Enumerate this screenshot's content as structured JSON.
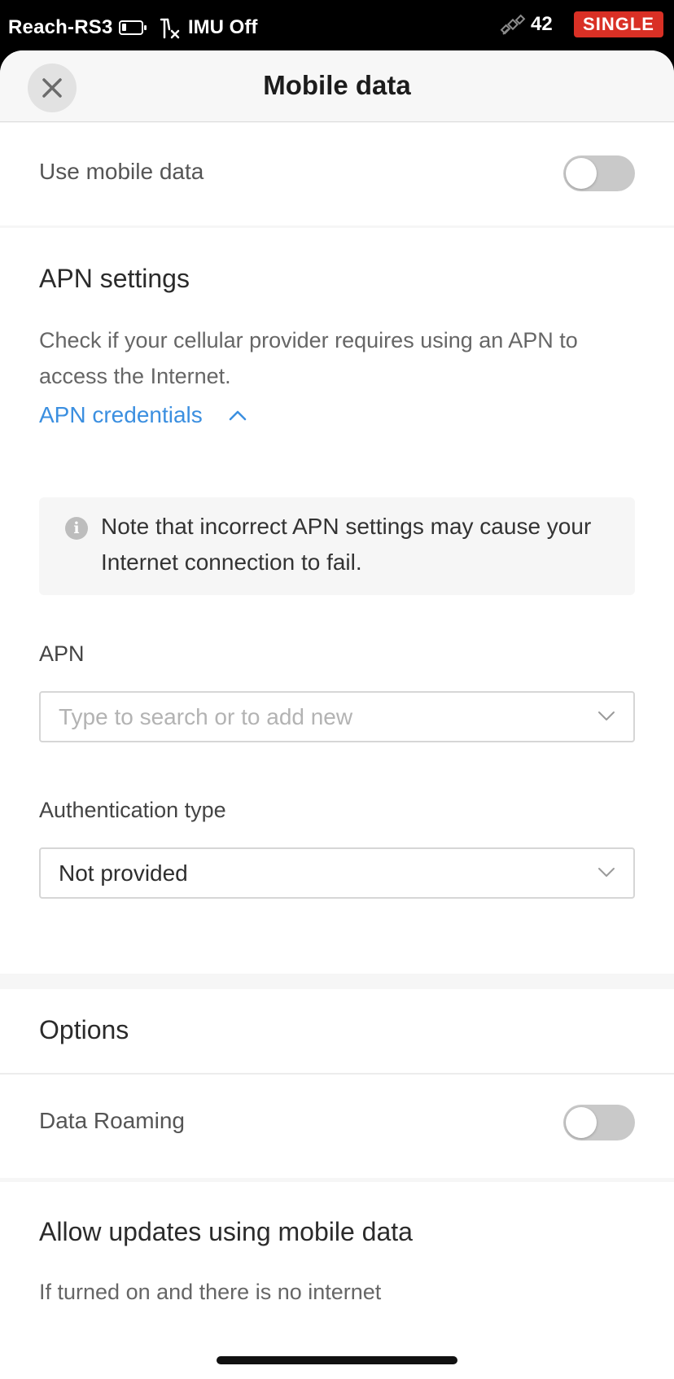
{
  "status_bar": {
    "device_name": "Reach-RS3",
    "imu_status": "IMU Off",
    "satellite_count": "42",
    "solution_badge": "SINGLE",
    "badge_color": "#d93025",
    "icons": [
      "battery-icon",
      "imu-off-icon",
      "satellite-icon"
    ]
  },
  "header": {
    "title": "Mobile data",
    "close_icon": "close-icon"
  },
  "mobile_data": {
    "label": "Use mobile data",
    "enabled": false
  },
  "apn_settings": {
    "title": "APN settings",
    "description": "Check if your cellular provider requires using an APN to access the Internet.",
    "credentials_link": "APN credentials",
    "credentials_expanded": true,
    "note": "Note that incorrect APN settings may cause your Internet connection to fail.",
    "note_icon": "info-icon",
    "apn_field": {
      "label": "APN",
      "placeholder": "Type to search or to add new",
      "value": ""
    },
    "auth_field": {
      "label": "Authentication type",
      "value": "Not provided"
    }
  },
  "options": {
    "title": "Options",
    "data_roaming": {
      "label": "Data Roaming",
      "enabled": false
    },
    "updates": {
      "title": "Allow updates using mobile data",
      "description": "If turned on and there is no internet"
    }
  },
  "colors": {
    "link": "#3b8fe0",
    "toggle_off": "#c9c9c9",
    "status_badge": "#d93025"
  }
}
